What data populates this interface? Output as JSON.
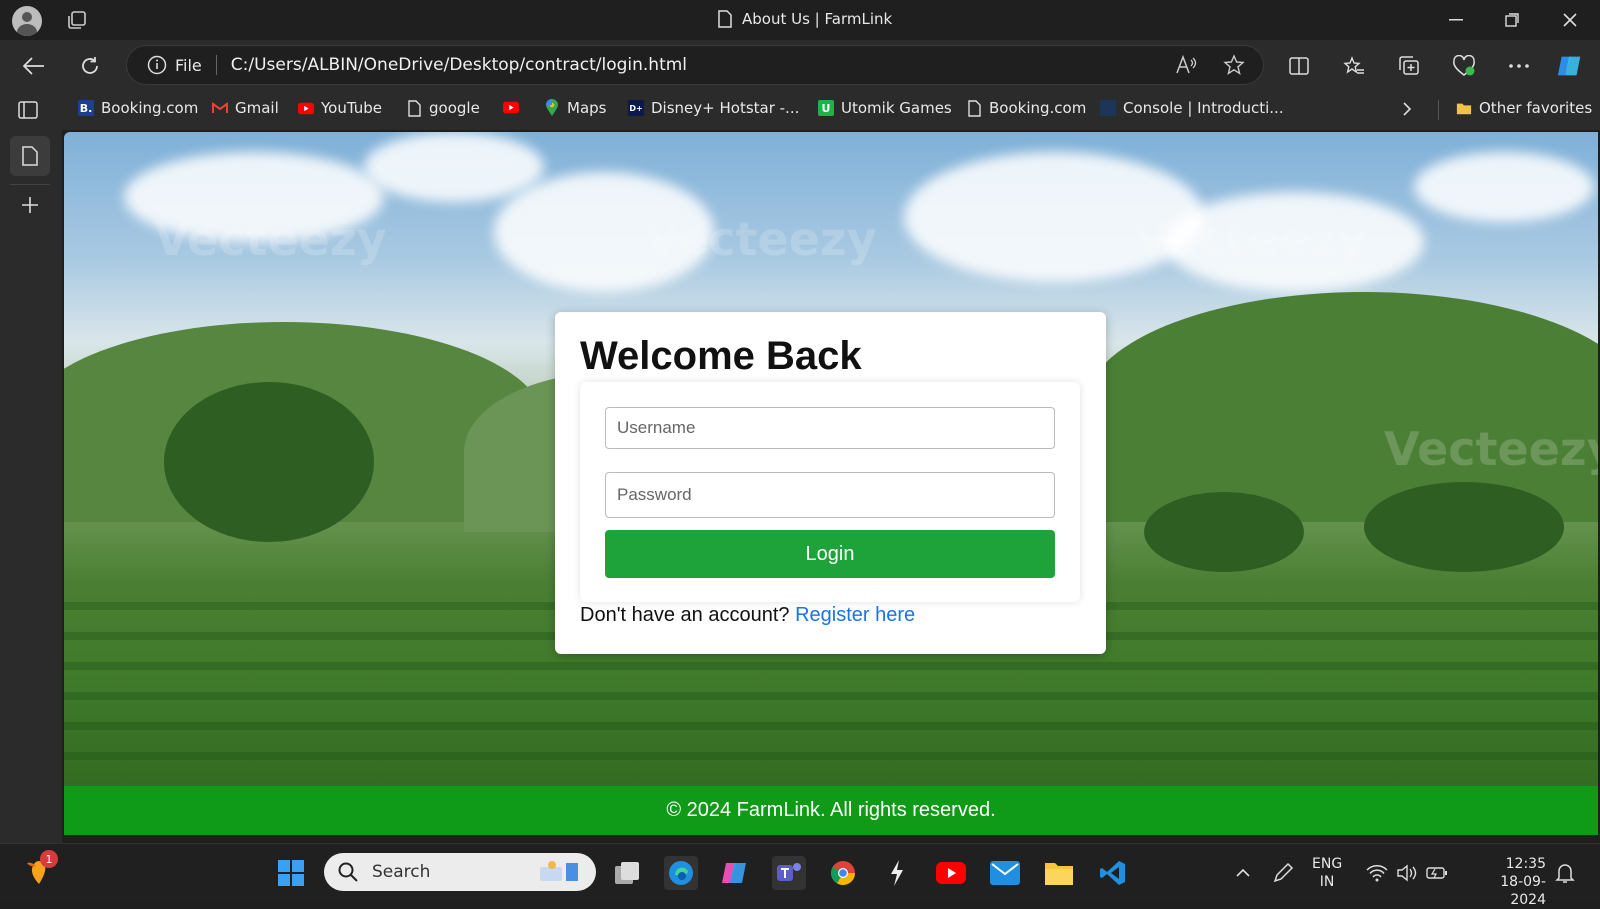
{
  "window": {
    "tab_title": "About Us | FarmLink"
  },
  "address_bar": {
    "scheme_label": "File",
    "url": "C:/Users/ALBIN/OneDrive/Desktop/contract/login.html"
  },
  "bookmarks": [
    {
      "label": "Booking.com",
      "icon": "booking-icon"
    },
    {
      "label": "Gmail",
      "icon": "gmail-icon"
    },
    {
      "label": "YouTube",
      "icon": "youtube-icon"
    },
    {
      "label": "google",
      "icon": "page-icon"
    },
    {
      "label": "",
      "icon": "youtube-icon"
    },
    {
      "label": "Maps",
      "icon": "maps-icon"
    },
    {
      "label": "Disney+ Hotstar -...",
      "icon": "hotstar-icon"
    },
    {
      "label": "Utomik Games",
      "icon": "utomik-icon"
    },
    {
      "label": "Booking.com",
      "icon": "page-icon"
    },
    {
      "label": "Console | Introducti...",
      "icon": "console-icon"
    }
  ],
  "other_favorites": "Other favorites",
  "page": {
    "watermark": "Vecteezy",
    "login": {
      "title": "Welcome Back",
      "username_placeholder": "Username",
      "password_placeholder": "Password",
      "button_label": "Login",
      "register_prompt": "Don't have an account?",
      "register_link": "Register here"
    },
    "footer": "© 2024 FarmLink. All rights reserved."
  },
  "taskbar": {
    "notification_count": "1",
    "search_label": "Search",
    "lang_line1": "ENG",
    "lang_line2": "IN",
    "time": "12:35",
    "date": "18-09-2024"
  },
  "colors": {
    "login_button": "#1ea33a",
    "footer": "#0f9a18",
    "link": "#1a73e8"
  }
}
